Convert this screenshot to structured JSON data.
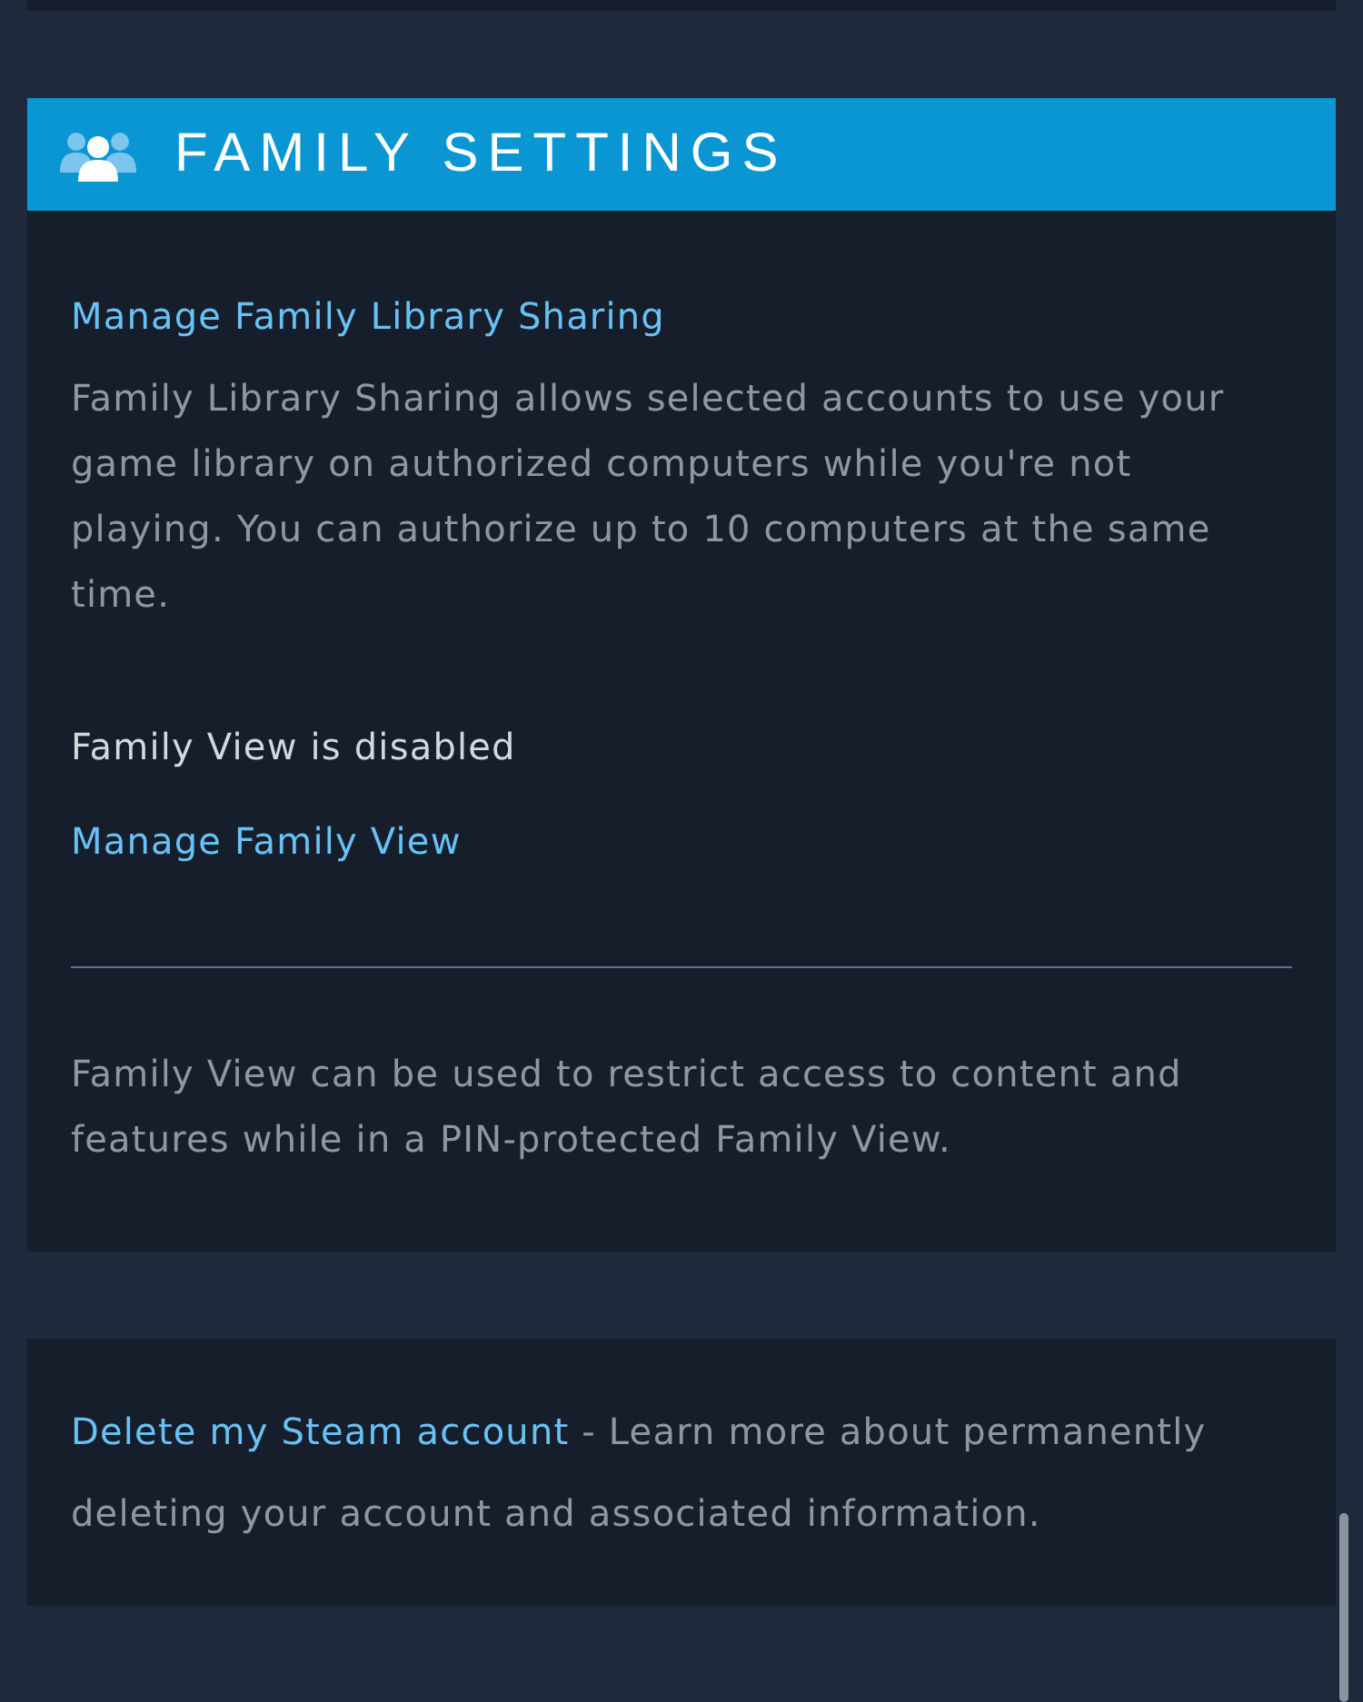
{
  "section_header": {
    "title": "FAMILY SETTINGS"
  },
  "family_settings": {
    "library_sharing_link": "Manage Family Library Sharing",
    "library_sharing_description": "Family Library Sharing allows selected accounts to use your game library on authorized computers while you're not playing. You can authorize up to 10 computers at the same time.",
    "family_view_status": "Family View is disabled",
    "family_view_link": "Manage Family View",
    "family_view_description": "Family View can be used to restrict access to content and features while in a PIN-protected Family View."
  },
  "delete_account": {
    "link": "Delete my Steam account",
    "text": "- Learn more about permanently deleting your account and associated information."
  }
}
